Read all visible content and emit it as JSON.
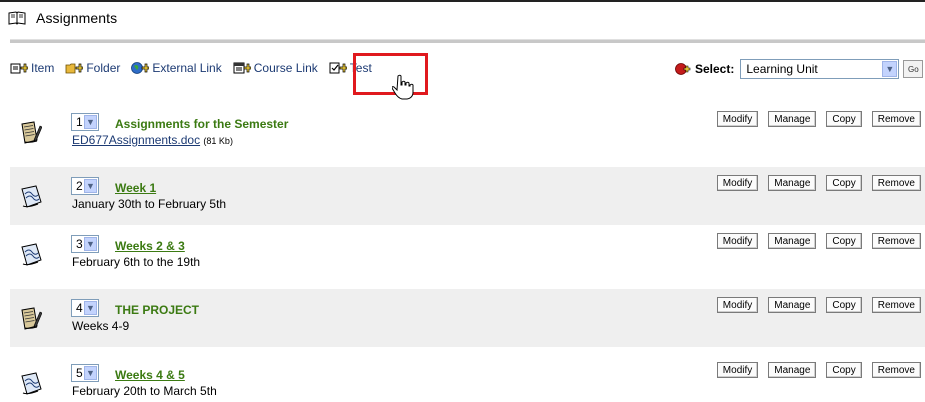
{
  "header": {
    "title": "Assignments",
    "icon": "book-icon"
  },
  "toolbar": {
    "items": [
      {
        "label": "Item",
        "icon": "add-item-icon"
      },
      {
        "label": "Folder",
        "icon": "add-folder-icon"
      },
      {
        "label": "External Link",
        "icon": "add-external-link-icon"
      },
      {
        "label": "Course Link",
        "icon": "add-course-link-icon"
      },
      {
        "label": "Test",
        "icon": "add-test-icon"
      }
    ],
    "select_label": "Select:",
    "select_value": "Learning Unit",
    "go_label": "Go"
  },
  "rows": [
    {
      "order": "1",
      "title": "Assignments for the Semester",
      "title_is_link": false,
      "sub_file": "ED677Assignments.doc",
      "sub_size": "(81 Kb)",
      "sub_text": "",
      "icon": "assignment-icon"
    },
    {
      "order": "2",
      "title": "Week 1",
      "title_is_link": true,
      "sub_file": "",
      "sub_size": "",
      "sub_text": "January 30th to February 5th",
      "icon": "learning-unit-icon"
    },
    {
      "order": "3",
      "title": "Weeks 2 & 3",
      "title_is_link": true,
      "sub_file": "",
      "sub_size": "",
      "sub_text": "February 6th to the 19th",
      "icon": "learning-unit-icon"
    },
    {
      "order": "4",
      "title": "THE PROJECT",
      "title_is_link": false,
      "sub_file": "",
      "sub_size": "",
      "sub_text": "Weeks 4-9",
      "icon": "assignment-icon"
    },
    {
      "order": "5",
      "title": "Weeks 4 & 5",
      "title_is_link": true,
      "sub_file": "",
      "sub_size": "",
      "sub_text": "February 20th  to March 5th",
      "icon": "learning-unit-icon"
    }
  ],
  "row_actions": {
    "modify": "Modify",
    "manage": "Manage",
    "copy": "Copy",
    "remove": "Remove"
  },
  "colors": {
    "title_green": "#3b7a12",
    "link_blue": "#1c3a73",
    "highlight_red": "#e0191e",
    "row_shade": "#efefef"
  }
}
